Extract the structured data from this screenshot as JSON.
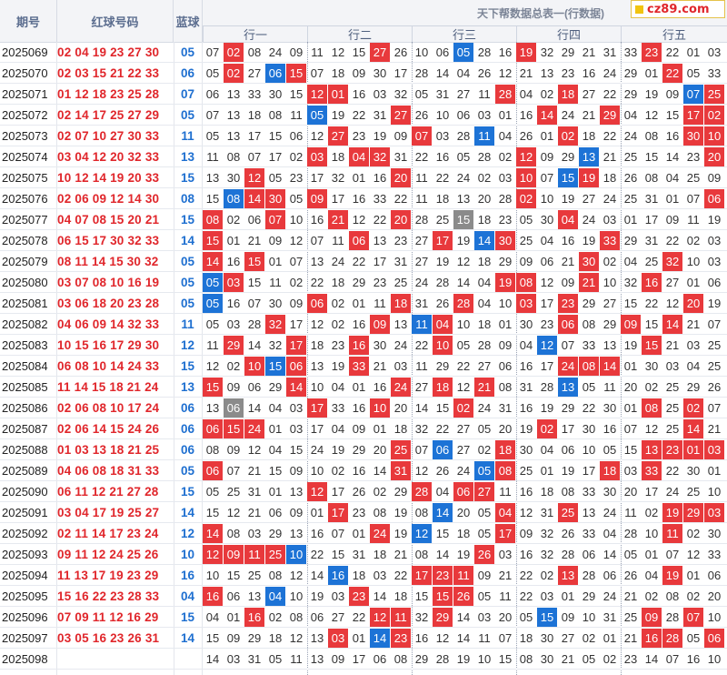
{
  "header": {
    "period_label": "期号",
    "red_label": "红球号码",
    "blue_label": "蓝球",
    "table_title": "天下帮数据总表一(行数据)",
    "groups": [
      "行一",
      "行二",
      "行三",
      "行四",
      "行五"
    ]
  },
  "watermark": {
    "text": "cz89.com"
  },
  "colors": {
    "red": "#e8393c",
    "blue": "#1d73d6",
    "gray": "#8b8b8b",
    "period_blue_text": "#1e6fd0",
    "red_text": "#e0262b"
  },
  "rows": [
    {
      "period": "2025069",
      "reds": "02 04 19 23 27 30",
      "blue": "05",
      "cells": [
        "07",
        "02",
        "08",
        "24",
        "09",
        "11",
        "12",
        "15",
        "27",
        "26",
        "10",
        "06",
        "05",
        "28",
        "16",
        "19",
        "32",
        "29",
        "21",
        "31",
        "33",
        "23",
        "22",
        "01",
        "03"
      ],
      "marks": ".r...|...r.|..b..|r....|.r..."
    },
    {
      "period": "2025070",
      "reds": "02 03 15 21 22 33",
      "blue": "06",
      "cells": [
        "05",
        "02",
        "27",
        "06",
        "15",
        "07",
        "18",
        "09",
        "30",
        "17",
        "28",
        "14",
        "04",
        "26",
        "12",
        "21",
        "13",
        "23",
        "16",
        "24",
        "29",
        "01",
        "22",
        "05",
        "33"
      ],
      "marks": ".r.br|.....|.....|.....|..r.."
    },
    {
      "period": "2025071",
      "reds": "01 12 18 23 25 28",
      "blue": "07",
      "cells": [
        "06",
        "13",
        "33",
        "30",
        "15",
        "12",
        "01",
        "16",
        "03",
        "32",
        "05",
        "31",
        "27",
        "11",
        "28",
        "04",
        "02",
        "18",
        "27",
        "22",
        "29",
        "19",
        "09",
        "07",
        "25"
      ],
      "marks": ".....|rr...|....r|..r..|...br"
    },
    {
      "period": "2025072",
      "reds": "02 14 17 25 27 29",
      "blue": "05",
      "cells": [
        "07",
        "13",
        "18",
        "08",
        "11",
        "05",
        "19",
        "22",
        "31",
        "27",
        "26",
        "10",
        "06",
        "03",
        "01",
        "16",
        "14",
        "24",
        "21",
        "29",
        "04",
        "12",
        "15",
        "17",
        "02"
      ],
      "marks": ".....|b...r|.....|.r..r|...rr"
    },
    {
      "period": "2025073",
      "reds": "02 07 10 27 30 33",
      "blue": "11",
      "cells": [
        "05",
        "13",
        "17",
        "15",
        "06",
        "12",
        "27",
        "23",
        "19",
        "09",
        "07",
        "03",
        "28",
        "11",
        "04",
        "26",
        "01",
        "02",
        "18",
        "22",
        "24",
        "08",
        "16",
        "30",
        "10"
      ],
      "marks": ".....|.r...|r..b.|..r..|...rr"
    },
    {
      "period": "2025074",
      "reds": "03 04 12 20 32 33",
      "blue": "13",
      "cells": [
        "11",
        "08",
        "07",
        "17",
        "02",
        "03",
        "18",
        "04",
        "32",
        "31",
        "22",
        "16",
        "05",
        "28",
        "02",
        "12",
        "09",
        "29",
        "13",
        "21",
        "25",
        "15",
        "14",
        "23",
        "20"
      ],
      "marks": ".....|r.rr.|.....|r..b.|....r"
    },
    {
      "period": "2025075",
      "reds": "10 12 14 19 20 33",
      "blue": "15",
      "cells": [
        "13",
        "30",
        "12",
        "05",
        "23",
        "17",
        "32",
        "01",
        "16",
        "20",
        "11",
        "22",
        "24",
        "02",
        "03",
        "10",
        "07",
        "15",
        "19",
        "18",
        "26",
        "08",
        "04",
        "25",
        "09"
      ],
      "marks": "..r..|....r|.....|r.br.|....."
    },
    {
      "period": "2025076",
      "reds": "02 06 09 12 14 30",
      "blue": "08",
      "cells": [
        "15",
        "08",
        "14",
        "30",
        "05",
        "09",
        "17",
        "16",
        "33",
        "22",
        "11",
        "18",
        "13",
        "20",
        "28",
        "02",
        "10",
        "19",
        "27",
        "24",
        "25",
        "31",
        "01",
        "07",
        "06"
      ],
      "marks": ".brr.|r....|.....|r....|....r"
    },
    {
      "period": "2025077",
      "reds": "04 07 08 15 20 21",
      "blue": "15",
      "cells": [
        "08",
        "02",
        "06",
        "07",
        "10",
        "16",
        "21",
        "12",
        "22",
        "20",
        "28",
        "25",
        "15",
        "18",
        "23",
        "05",
        "30",
        "04",
        "24",
        "03",
        "01",
        "17",
        "09",
        "11",
        "19"
      ],
      "marks": "r..r.|.r..r|..g..|..r..|....."
    },
    {
      "period": "2025078",
      "reds": "06 15 17 30 32 33",
      "blue": "14",
      "cells": [
        "15",
        "01",
        "21",
        "09",
        "12",
        "07",
        "11",
        "06",
        "13",
        "23",
        "27",
        "17",
        "19",
        "14",
        "30",
        "25",
        "04",
        "16",
        "19",
        "33",
        "29",
        "31",
        "22",
        "02",
        "03"
      ],
      "marks": "r....|..r..|.r.br|....r|....."
    },
    {
      "period": "2025079",
      "reds": "08 11 14 15 30 32",
      "blue": "05",
      "cells": [
        "14",
        "16",
        "15",
        "01",
        "07",
        "13",
        "24",
        "22",
        "17",
        "31",
        "27",
        "19",
        "12",
        "18",
        "29",
        "09",
        "06",
        "21",
        "30",
        "02",
        "04",
        "25",
        "32",
        "10",
        "03"
      ],
      "marks": "r.r..|.....|.....|...r.|..r.."
    },
    {
      "period": "2025080",
      "reds": "03 07 08 10 16 19",
      "blue": "05",
      "cells": [
        "05",
        "03",
        "15",
        "11",
        "02",
        "22",
        "18",
        "29",
        "23",
        "25",
        "24",
        "28",
        "14",
        "04",
        "19",
        "08",
        "12",
        "09",
        "21",
        "10",
        "32",
        "16",
        "27",
        "01",
        "06"
      ],
      "marks": "br...|.....|....r|r..r.|.r..."
    },
    {
      "period": "2025081",
      "reds": "03 06 18 20 23 28",
      "blue": "05",
      "cells": [
        "05",
        "16",
        "07",
        "30",
        "09",
        "06",
        "02",
        "01",
        "11",
        "18",
        "31",
        "26",
        "28",
        "04",
        "10",
        "03",
        "17",
        "23",
        "29",
        "27",
        "15",
        "22",
        "12",
        "20",
        "19"
      ],
      "marks": "b....|r...r|..r..|r.r..|...r."
    },
    {
      "period": "2025082",
      "reds": "04 06 09 14 32 33",
      "blue": "11",
      "cells": [
        "05",
        "03",
        "28",
        "32",
        "17",
        "12",
        "02",
        "16",
        "09",
        "13",
        "11",
        "04",
        "10",
        "18",
        "01",
        "30",
        "23",
        "06",
        "08",
        "29",
        "09",
        "15",
        "14",
        "21",
        "07"
      ],
      "marks": "...r.|...r.|br...|..r..|r.r.."
    },
    {
      "period": "2025083",
      "reds": "10 15 16 17 29 30",
      "blue": "12",
      "cells": [
        "11",
        "29",
        "14",
        "32",
        "17",
        "18",
        "23",
        "16",
        "30",
        "24",
        "22",
        "10",
        "05",
        "28",
        "09",
        "04",
        "12",
        "07",
        "33",
        "13",
        "19",
        "15",
        "21",
        "03",
        "25"
      ],
      "marks": ".r..r|..r..|.r...|.b...|.r..."
    },
    {
      "period": "2025084",
      "reds": "06 08 10 14 24 33",
      "blue": "15",
      "cells": [
        "12",
        "02",
        "10",
        "15",
        "06",
        "13",
        "19",
        "33",
        "21",
        "03",
        "11",
        "29",
        "22",
        "27",
        "06",
        "16",
        "17",
        "24",
        "08",
        "14",
        "01",
        "30",
        "03",
        "04",
        "25"
      ],
      "marks": "..rbr|..r..|.....|..rrr|....."
    },
    {
      "period": "2025085",
      "reds": "11 14 15 18 21 24",
      "blue": "13",
      "cells": [
        "15",
        "09",
        "06",
        "29",
        "14",
        "10",
        "04",
        "01",
        "16",
        "24",
        "27",
        "18",
        "12",
        "21",
        "08",
        "31",
        "28",
        "13",
        "05",
        "11",
        "20",
        "02",
        "25",
        "29",
        "26"
      ],
      "marks": "r...r|....r|.r.r.|..b..|....."
    },
    {
      "period": "2025086",
      "reds": "02 06 08 10 17 24",
      "blue": "06",
      "cells": [
        "13",
        "06",
        "14",
        "04",
        "03",
        "17",
        "33",
        "16",
        "10",
        "20",
        "14",
        "15",
        "02",
        "24",
        "31",
        "16",
        "19",
        "29",
        "22",
        "30",
        "01",
        "08",
        "25",
        "02",
        "07"
      ],
      "marks": ".g...|r..r.|..r..|.....|.r.r."
    },
    {
      "period": "2025087",
      "reds": "02 06 14 15 24 26",
      "blue": "06",
      "cells": [
        "06",
        "15",
        "24",
        "01",
        "03",
        "17",
        "04",
        "09",
        "01",
        "18",
        "32",
        "22",
        "27",
        "05",
        "20",
        "19",
        "02",
        "17",
        "30",
        "16",
        "07",
        "12",
        "25",
        "14",
        "21"
      ],
      "marks": "rrr..|.....|.....|.r...|...r."
    },
    {
      "period": "2025088",
      "reds": "01 03 13 18 21 25",
      "blue": "06",
      "cells": [
        "08",
        "09",
        "12",
        "04",
        "15",
        "24",
        "19",
        "29",
        "20",
        "25",
        "07",
        "06",
        "27",
        "02",
        "18",
        "30",
        "04",
        "06",
        "10",
        "05",
        "15",
        "13",
        "23",
        "01",
        "03"
      ],
      "marks": ".....|....r|.b..r|.....|.rrrr"
    },
    {
      "period": "2025089",
      "reds": "04 06 08 18 31 33",
      "blue": "05",
      "cells": [
        "06",
        "07",
        "21",
        "15",
        "09",
        "10",
        "02",
        "16",
        "14",
        "31",
        "12",
        "26",
        "24",
        "05",
        "08",
        "25",
        "01",
        "19",
        "17",
        "18",
        "03",
        "33",
        "22",
        "30",
        "01"
      ],
      "marks": "r....|....r|...br|....r|.r..."
    },
    {
      "period": "2025090",
      "reds": "06 11 12 21 27 28",
      "blue": "15",
      "cells": [
        "05",
        "25",
        "31",
        "01",
        "13",
        "12",
        "17",
        "26",
        "02",
        "29",
        "28",
        "04",
        "06",
        "27",
        "11",
        "16",
        "18",
        "08",
        "33",
        "30",
        "20",
        "17",
        "24",
        "25",
        "10"
      ],
      "marks": ".....|r....|r.rr.|.....|....."
    },
    {
      "period": "2025091",
      "reds": "03 04 17 19 25 27",
      "blue": "14",
      "cells": [
        "15",
        "12",
        "21",
        "06",
        "09",
        "01",
        "17",
        "23",
        "08",
        "19",
        "08",
        "14",
        "20",
        "05",
        "04",
        "12",
        "31",
        "25",
        "13",
        "24",
        "11",
        "02",
        "19",
        "29",
        "03"
      ],
      "marks": ".....|.r...|.b..r|..r..|..rrr"
    },
    {
      "period": "2025092",
      "reds": "02 11 14 17 23 24",
      "blue": "12",
      "cells": [
        "14",
        "08",
        "03",
        "29",
        "13",
        "16",
        "07",
        "01",
        "24",
        "19",
        "12",
        "15",
        "18",
        "05",
        "17",
        "09",
        "32",
        "26",
        "33",
        "04",
        "28",
        "10",
        "11",
        "02",
        "30"
      ],
      "marks": "r....|...r.|b...r|.....|..r.."
    },
    {
      "period": "2025093",
      "reds": "09 11 12 24 25 26",
      "blue": "10",
      "cells": [
        "12",
        "09",
        "11",
        "25",
        "10",
        "22",
        "15",
        "31",
        "18",
        "21",
        "08",
        "14",
        "19",
        "26",
        "03",
        "16",
        "32",
        "28",
        "06",
        "14",
        "05",
        "01",
        "07",
        "12",
        "33"
      ],
      "marks": "rrrrb|.....|...r.|.....|....."
    },
    {
      "period": "2025094",
      "reds": "11 13 17 19 23 29",
      "blue": "16",
      "cells": [
        "10",
        "15",
        "25",
        "08",
        "12",
        "14",
        "16",
        "18",
        "03",
        "22",
        "17",
        "23",
        "11",
        "09",
        "21",
        "22",
        "02",
        "13",
        "28",
        "06",
        "26",
        "04",
        "19",
        "01",
        "06"
      ],
      "marks": ".....|.b...|rrr..|..r..|..r.."
    },
    {
      "period": "2025095",
      "reds": "15 16 22 23 28 33",
      "blue": "04",
      "cells": [
        "16",
        "06",
        "13",
        "04",
        "10",
        "19",
        "03",
        "23",
        "14",
        "18",
        "15",
        "15",
        "26",
        "05",
        "11",
        "22",
        "03",
        "01",
        "29",
        "24",
        "21",
        "02",
        "08",
        "02",
        "20"
      ],
      "marks": "r..b.|..r..|.rr..|.....|....."
    },
    {
      "period": "2025096",
      "reds": "07 09 11 12 16 29",
      "blue": "15",
      "cells": [
        "04",
        "01",
        "16",
        "02",
        "08",
        "06",
        "27",
        "22",
        "12",
        "11",
        "32",
        "29",
        "14",
        "03",
        "20",
        "05",
        "15",
        "09",
        "10",
        "31",
        "25",
        "09",
        "28",
        "07",
        "10"
      ],
      "marks": "..r..|...rr|.r...|.b...|.r.r."
    },
    {
      "period": "2025097",
      "reds": "03 05 16 23 26 31",
      "blue": "14",
      "cells": [
        "15",
        "09",
        "29",
        "18",
        "12",
        "13",
        "03",
        "01",
        "14",
        "23",
        "16",
        "12",
        "14",
        "11",
        "07",
        "18",
        "30",
        "27",
        "02",
        "01",
        "21",
        "16",
        "28",
        "05",
        "06"
      ],
      "marks": ".....|.r.br|.....|.....|.rr.r"
    },
    {
      "period": "2025098",
      "reds": "",
      "blue": "",
      "cells": [
        "14",
        "03",
        "31",
        "05",
        "11",
        "13",
        "09",
        "17",
        "06",
        "08",
        "29",
        "28",
        "19",
        "10",
        "15",
        "08",
        "30",
        "21",
        "05",
        "02",
        "23",
        "14",
        "07",
        "16",
        "10"
      ],
      "marks": ".....|.....|.....|.....|....."
    }
  ]
}
